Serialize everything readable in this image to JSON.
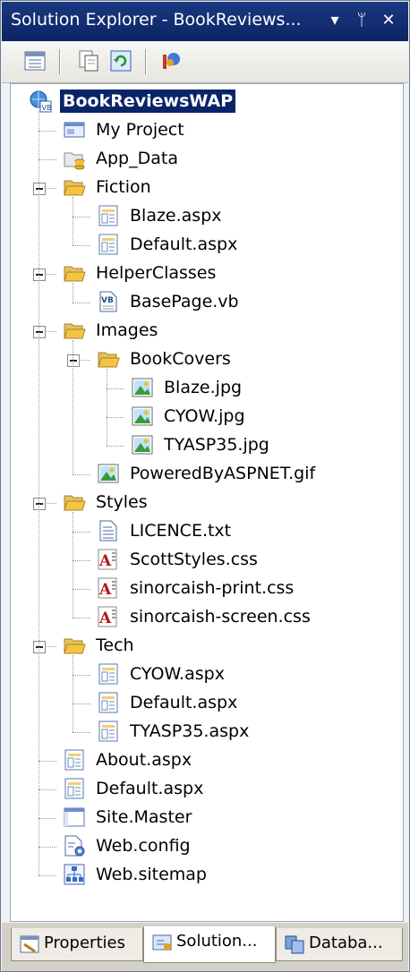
{
  "window": {
    "title": "Solution Explorer - BookReviews...",
    "buttons": {
      "dropdown": "▾",
      "pin": "ᛘ",
      "close": "✕"
    }
  },
  "toolbar": {
    "icons": [
      "properties-icon",
      "show-all-files-icon",
      "refresh-icon",
      "class-diagram-icon"
    ]
  },
  "tree": [
    {
      "label": "BookReviewsWAP",
      "icon": "web-project-icon",
      "depth": 0,
      "selected": true
    },
    {
      "label": "My Project",
      "icon": "my-project-icon",
      "depth": 1
    },
    {
      "label": "App_Data",
      "icon": "app-data-folder-icon",
      "depth": 1
    },
    {
      "label": "Fiction",
      "icon": "folder-open-icon",
      "depth": 1,
      "expanded": true
    },
    {
      "label": "Blaze.aspx",
      "icon": "aspx-file-icon",
      "depth": 2
    },
    {
      "label": "Default.aspx",
      "icon": "aspx-file-icon",
      "depth": 2
    },
    {
      "label": "HelperClasses",
      "icon": "folder-open-icon",
      "depth": 1,
      "expanded": true
    },
    {
      "label": "BasePage.vb",
      "icon": "vb-file-icon",
      "depth": 2
    },
    {
      "label": "Images",
      "icon": "folder-open-icon",
      "depth": 1,
      "expanded": true
    },
    {
      "label": "BookCovers",
      "icon": "folder-open-icon",
      "depth": 2,
      "expanded": true
    },
    {
      "label": "Blaze.jpg",
      "icon": "image-file-icon",
      "depth": 3
    },
    {
      "label": "CYOW.jpg",
      "icon": "image-file-icon",
      "depth": 3
    },
    {
      "label": "TYASP35.jpg",
      "icon": "image-file-icon",
      "depth": 3
    },
    {
      "label": "PoweredByASPNET.gif",
      "icon": "image-file-icon",
      "depth": 2
    },
    {
      "label": "Styles",
      "icon": "folder-open-icon",
      "depth": 1,
      "expanded": true
    },
    {
      "label": "LICENCE.txt",
      "icon": "text-file-icon",
      "depth": 2
    },
    {
      "label": "ScottStyles.css",
      "icon": "css-file-icon",
      "depth": 2
    },
    {
      "label": "sinorcaish-print.css",
      "icon": "css-file-icon",
      "depth": 2
    },
    {
      "label": "sinorcaish-screen.css",
      "icon": "css-file-icon",
      "depth": 2
    },
    {
      "label": "Tech",
      "icon": "folder-open-icon",
      "depth": 1,
      "expanded": true
    },
    {
      "label": "CYOW.aspx",
      "icon": "aspx-file-icon",
      "depth": 2
    },
    {
      "label": "Default.aspx",
      "icon": "aspx-file-icon",
      "depth": 2
    },
    {
      "label": "TYASP35.aspx",
      "icon": "aspx-file-icon",
      "depth": 2
    },
    {
      "label": "About.aspx",
      "icon": "aspx-file-icon",
      "depth": 1
    },
    {
      "label": "Default.aspx",
      "icon": "aspx-file-icon",
      "depth": 1
    },
    {
      "label": "Site.Master",
      "icon": "master-page-icon",
      "depth": 1
    },
    {
      "label": "Web.config",
      "icon": "config-file-icon",
      "depth": 1
    },
    {
      "label": "Web.sitemap",
      "icon": "sitemap-file-icon",
      "depth": 1
    }
  ],
  "tabs": [
    {
      "label": "Properties",
      "icon": "properties-tab-icon",
      "active": false
    },
    {
      "label": "Solution...",
      "icon": "solution-explorer-tab-icon",
      "active": true
    },
    {
      "label": "Databa...",
      "icon": "database-explorer-tab-icon",
      "active": false
    }
  ],
  "colors": {
    "titlebar": "#0c2464",
    "selection": "#0a246a",
    "folder": "#f5c542"
  }
}
